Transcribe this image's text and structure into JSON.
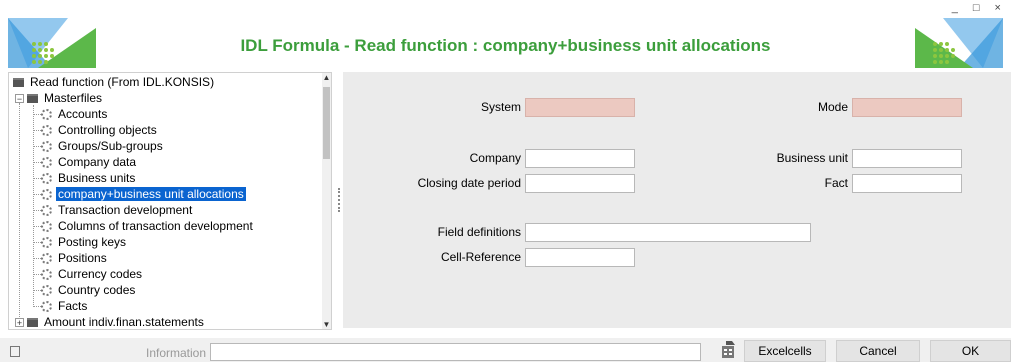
{
  "window": {
    "title": "IDL Formula - Read function : company+business unit allocations",
    "controls": "_ □ ×"
  },
  "tree": {
    "root_label": "Read function (From IDL.KONSIS)",
    "masterfiles_label": "Masterfiles",
    "items": [
      {
        "label": "Accounts"
      },
      {
        "label": "Controlling objects"
      },
      {
        "label": "Groups/Sub-groups"
      },
      {
        "label": "Company data"
      },
      {
        "label": "Business units"
      },
      {
        "label": "company+business unit allocations",
        "selected": true
      },
      {
        "label": "Transaction development"
      },
      {
        "label": "Columns of transaction development"
      },
      {
        "label": "Posting keys"
      },
      {
        "label": "Positions"
      },
      {
        "label": "Currency codes"
      },
      {
        "label": "Country codes"
      },
      {
        "label": "Facts"
      }
    ],
    "next_folder_label": "Amount indiv.finan.statements"
  },
  "form": {
    "system_label": "System",
    "system_value": "",
    "mode_label": "Mode",
    "mode_value": "",
    "company_label": "Company",
    "company_value": "",
    "business_unit_label": "Business unit",
    "business_unit_value": "",
    "closing_date_label": "Closing date period",
    "closing_date_value": "",
    "fact_label": "Fact",
    "fact_value": "",
    "field_definitions_label": "Field definitions",
    "field_definitions_value": "",
    "cell_reference_label": "Cell-Reference",
    "cell_reference_value": ""
  },
  "statusbar": {
    "info_label": "Information",
    "info_value": "",
    "excelcells_label": "Excelcells",
    "cancel_label": "Cancel",
    "ok_label": "OK"
  },
  "colors": {
    "title_green": "#3c9e3c",
    "selection_blue": "#0a64d0",
    "readonly_field": "#ecc9c1",
    "form_bg": "#ebebeb"
  },
  "icons": {
    "logo": "idl-logo-icon",
    "tree_folder": "folder-icon",
    "tree_leaf": "gear-icon",
    "excel": "excel-icon"
  }
}
